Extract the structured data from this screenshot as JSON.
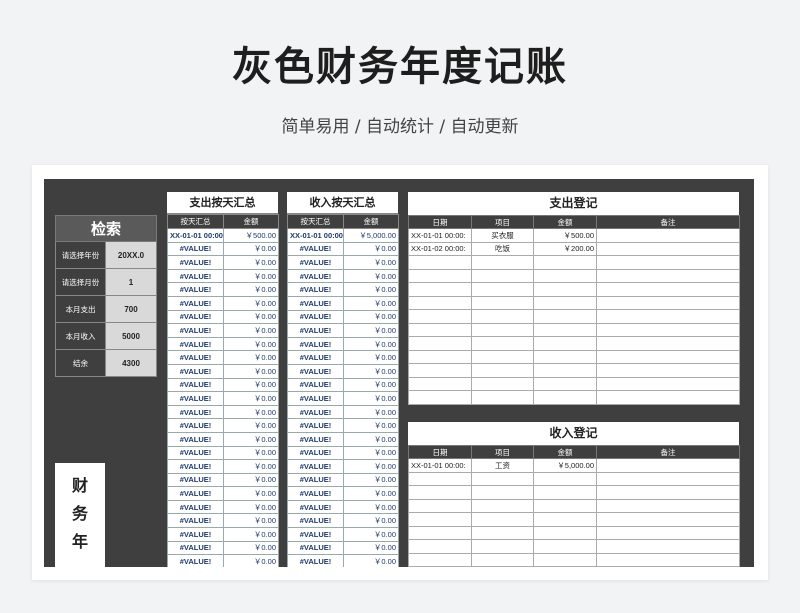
{
  "title": "灰色财务年度记账",
  "subtitle": "简单易用  /  自动统计  /  自动更新",
  "search": {
    "heading": "检索",
    "rows": [
      {
        "label": "请选择年份",
        "value": "20XX.0"
      },
      {
        "label": "请选择月份",
        "value": "1"
      },
      {
        "label": "本月支出",
        "value": "700"
      },
      {
        "label": "本月收入",
        "value": "5000"
      },
      {
        "label": "结余",
        "value": "4300"
      }
    ]
  },
  "vertical_title": [
    "财",
    "务",
    "年"
  ],
  "expense_summary": {
    "caption": "支出按天汇总",
    "headers": [
      "按天汇总",
      "金额"
    ],
    "first_row": [
      "XX-01-01 00:00",
      "￥500.00"
    ],
    "other_date": "#VALUE!",
    "other_amount": "￥0.00"
  },
  "income_summary": {
    "caption": "收入按天汇总",
    "headers": [
      "按天汇总",
      "金额"
    ],
    "first_row": [
      "XX-01-01 00:00",
      "￥5,000.00"
    ],
    "other_date": "#VALUE!",
    "other_amount": "￥0.00"
  },
  "expense_register": {
    "caption": "支出登记",
    "headers": [
      "日期",
      "项目",
      "金额",
      "备注"
    ],
    "rows": [
      [
        "XX-01-01 00:00:",
        "买衣服",
        "￥500.00",
        ""
      ],
      [
        "XX-01-02 00:00:",
        "吃饭",
        "￥200.00",
        ""
      ]
    ]
  },
  "income_register": {
    "caption": "收入登记",
    "headers": [
      "日期",
      "项目",
      "金额",
      "备注"
    ],
    "rows": [
      [
        "XX-01-01 00:00:",
        "工资",
        "￥5,000.00",
        ""
      ]
    ]
  },
  "colors": {
    "sheet_bg": "#3f3f3f",
    "header_bg": "#3f3f3f",
    "value_bg": "#d9d9d9",
    "link_blue": "#1f3a6d"
  }
}
